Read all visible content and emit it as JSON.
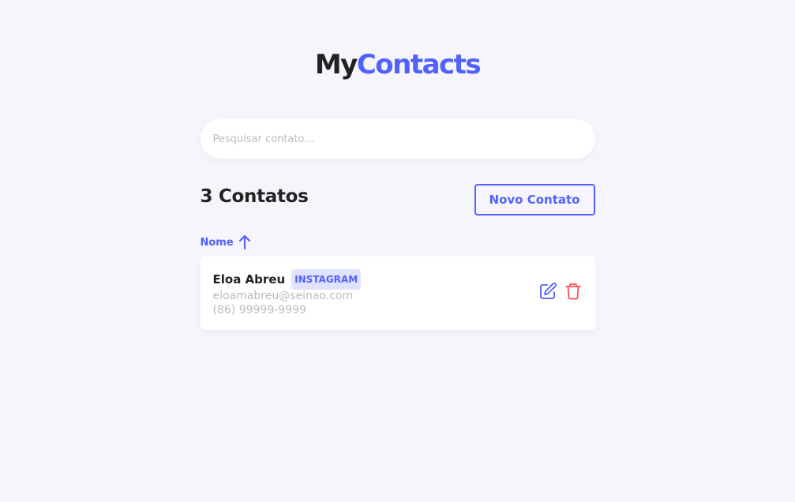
{
  "logo": {
    "part1": "My",
    "part2": "Contacts"
  },
  "search": {
    "placeholder": "Pesquisar contato..."
  },
  "list": {
    "count_title": "3 Contatos",
    "new_button": "Novo Contato",
    "sort_label": "Nome",
    "sort_icon": "arrow-up-icon"
  },
  "contacts": [
    {
      "name": "Eloa Abreu",
      "category": "INSTAGRAM",
      "email": "eloamabreu@seinao.com",
      "phone": "(86) 99999-9999",
      "edit_icon": "edit-icon",
      "delete_icon": "trash-icon"
    }
  ],
  "colors": {
    "primary": "#5061fc",
    "danger": "#fc5050",
    "background": "#f6f5fc",
    "text": "#222222",
    "muted": "#bcbcbc",
    "badge_bg": "#e0e3ff"
  }
}
